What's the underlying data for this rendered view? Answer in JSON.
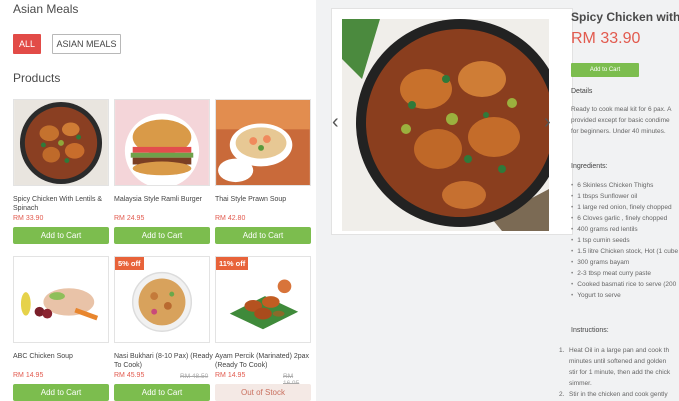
{
  "catalog": {
    "category_title": "Asian Meals",
    "filters": [
      {
        "label": "ALL",
        "active": true
      },
      {
        "label": "ASIAN MEALS",
        "active": false
      }
    ],
    "products_heading": "Products",
    "products": [
      {
        "name": "Spicy Chicken With Lentils & Spinach",
        "price": "RM 33.90",
        "action": "Add to Cart"
      },
      {
        "name": "Malaysia Style Ramli Burger",
        "price": "RM 24.95",
        "action": "Add to Cart"
      },
      {
        "name": "Thai Style Prawn Soup",
        "price": "RM 42.80",
        "action": "Add to Cart"
      },
      {
        "name": "ABC Chicken Soup",
        "price": "RM 14.95",
        "action": "Add to Cart"
      },
      {
        "name": "Nasi Bukhari (8-10 Pax) (Ready To Cook)",
        "price": "RM 45.95",
        "old_price": "RM 48.50",
        "badge": "5% off",
        "action": "Add to Cart"
      },
      {
        "name": "Ayam Percik (Marinated) 2pax (Ready To Cook)",
        "price": "RM 14.95",
        "old_price": "RM 16.95",
        "badge": "11% off",
        "action": "Out of Stock"
      }
    ]
  },
  "detail": {
    "title": "Spicy Chicken with",
    "price": "RM 33.90",
    "add_to_cart": "Add to Cart",
    "details_heading": "Details",
    "description_lines": [
      "Ready to cook meal kit for 6 pax. A",
      "provided except for basic condime",
      "for beginners. Under 40 minutes."
    ],
    "ingredients_heading": "Ingredients:",
    "ingredients": [
      "6 Skinless Chicken Thighs",
      "1 tbsps Sunflower oil",
      "1 large red onion, finely chopped",
      "6 Cloves garlic , finely chopped",
      "400 grams red lentils",
      "1 tsp cumin seeds",
      "1.5 litre Chicken stock, Hot (1 cube",
      "300 grams bayam",
      "2-3 tbsp meat curry paste",
      "Cooked basmati rice to serve (200",
      "Yogurt to serve"
    ],
    "instructions_heading": "Instructions:",
    "instructions": [
      {
        "num": "1.",
        "lines": [
          "Heat Oil in a large pan and cook th",
          "minutes until softened and golden",
          "stir for 1 minute, then add the chick",
          "simmer."
        ]
      },
      {
        "num": "2.",
        "lines": [
          "Stir in the chicken and cook gently"
        ]
      }
    ],
    "nav": {
      "prev_icon": "chevron-left-icon",
      "next_icon": "chevron-right-icon"
    }
  },
  "colors": {
    "accent_red": "#e24b47",
    "price_red": "#e25a4e",
    "cart_green": "#7cbd4e",
    "badge_orange": "#e8633a"
  }
}
